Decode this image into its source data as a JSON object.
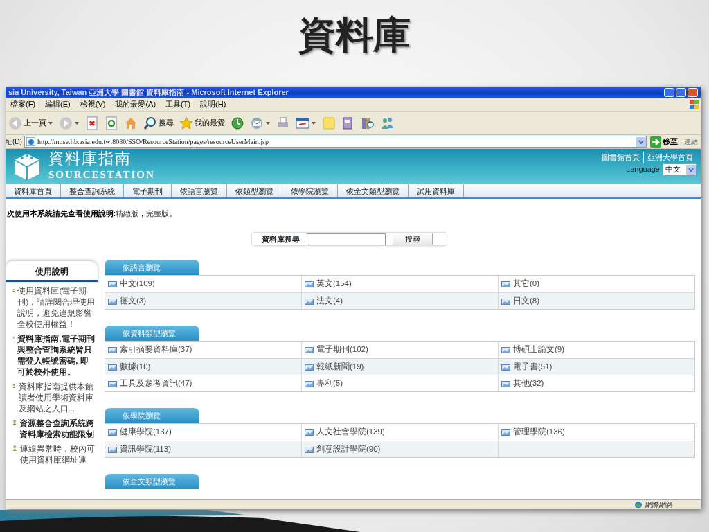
{
  "slide_title": "資料庫",
  "window": {
    "title": "sia University, Taiwan 亞洲大學 圖書館 資料庫指南 - Microsoft Internet Explorer",
    "menu": [
      "檔案(F)",
      "編輯(E)",
      "檢視(V)",
      "我的最愛(A)",
      "工具(T)",
      "說明(H)"
    ],
    "toolbar": [
      {
        "kind": "back",
        "label": "上一頁",
        "dropdown": true
      },
      {
        "kind": "forward",
        "dropdown": true
      },
      {
        "kind": "stop",
        "dropdown": false
      },
      {
        "kind": "refresh",
        "dropdown": false
      },
      {
        "kind": "home",
        "dropdown": false
      },
      {
        "kind": "search",
        "label": "搜尋",
        "dropdown": false
      },
      {
        "kind": "favorites",
        "label": "我的最愛",
        "dropdown": false
      },
      {
        "kind": "history",
        "dropdown": false
      },
      {
        "kind": "mail",
        "dropdown": true
      },
      {
        "kind": "print",
        "dropdown": false
      },
      {
        "kind": "edit",
        "dropdown": true
      },
      {
        "kind": "note",
        "dropdown": false
      },
      {
        "kind": "research",
        "dropdown": false
      },
      {
        "kind": "library",
        "dropdown": false
      },
      {
        "kind": "messenger",
        "dropdown": false
      }
    ],
    "address": {
      "label": "址(D)",
      "url": "http://muse.lib.asia.edu.tw:8080/SSO/ResourceStation/pages/resourceUserMain.jsp",
      "go": "移至",
      "links": "連結"
    },
    "status_bar": {
      "zone": "網際網路"
    }
  },
  "site": {
    "title": "資料庫指南",
    "subtitle": "SOURCESTATION",
    "top_links": [
      "圖書館首頁",
      "亞洲大學首頁"
    ],
    "language_label": "Language",
    "language": "中文",
    "nav": [
      "資料庫首頁",
      "整合查詢系統",
      "電子期刊",
      "依語言瀏覽",
      "依類型瀏覽",
      "依學院瀏覽",
      "依全文類型瀏覽",
      "試用資料庫"
    ]
  },
  "notice": {
    "lead": "次使用本系統請先查看使用說明",
    "colon": ":",
    "links": [
      {
        "label": "精緻版",
        "suffix": "，"
      },
      {
        "label": "完整版",
        "suffix": "。"
      }
    ]
  },
  "search": {
    "label": "資料庫搜尋",
    "button": "搜尋"
  },
  "sidebar": {
    "title": "使用說明",
    "items": [
      {
        "text": "使用資料庫(電子期刊)，請詳閱合理使用說明，避免違規影響全校使用權益！",
        "bold": false
      },
      {
        "text": "資料庫指南,電子期刊與整合查詢系統皆只需登入帳號密碼, 即可於校外使用。",
        "bold": true
      },
      {
        "text": "資料庫指南提供本館讀者使用學術資料庫及網站之入口...",
        "bold": false
      },
      {
        "text": "資源整合查詢系統跨資料庫檢索功能限制",
        "bold": true
      },
      {
        "text": "連線異常時，校內可使用資料庫網址連",
        "bold": false
      }
    ]
  },
  "sections": [
    {
      "title": "依語言瀏覽",
      "rows": [
        [
          "中文(109)",
          "英文(154)",
          "其它(0)"
        ],
        [
          "德文(3)",
          "法文(4)",
          "日文(8)"
        ]
      ]
    },
    {
      "title": "依資料類型瀏覽",
      "rows": [
        [
          "索引摘要資料庫(37)",
          "電子期刊(102)",
          "博碩士論文(9)"
        ],
        [
          "數據(10)",
          "報紙新聞(19)",
          "電子書(51)"
        ],
        [
          "工具及參考資訊(47)",
          "專利(5)",
          "其他(32)"
        ]
      ]
    },
    {
      "title": "依學院瀏覽",
      "rows": [
        [
          "健康學院(137)",
          "人文社會學院(139)",
          "管理學院(136)"
        ],
        [
          "資訊學院(113)",
          "創意設計學院(90)"
        ]
      ]
    },
    {
      "title": "依全文類型瀏覽"
    }
  ]
}
